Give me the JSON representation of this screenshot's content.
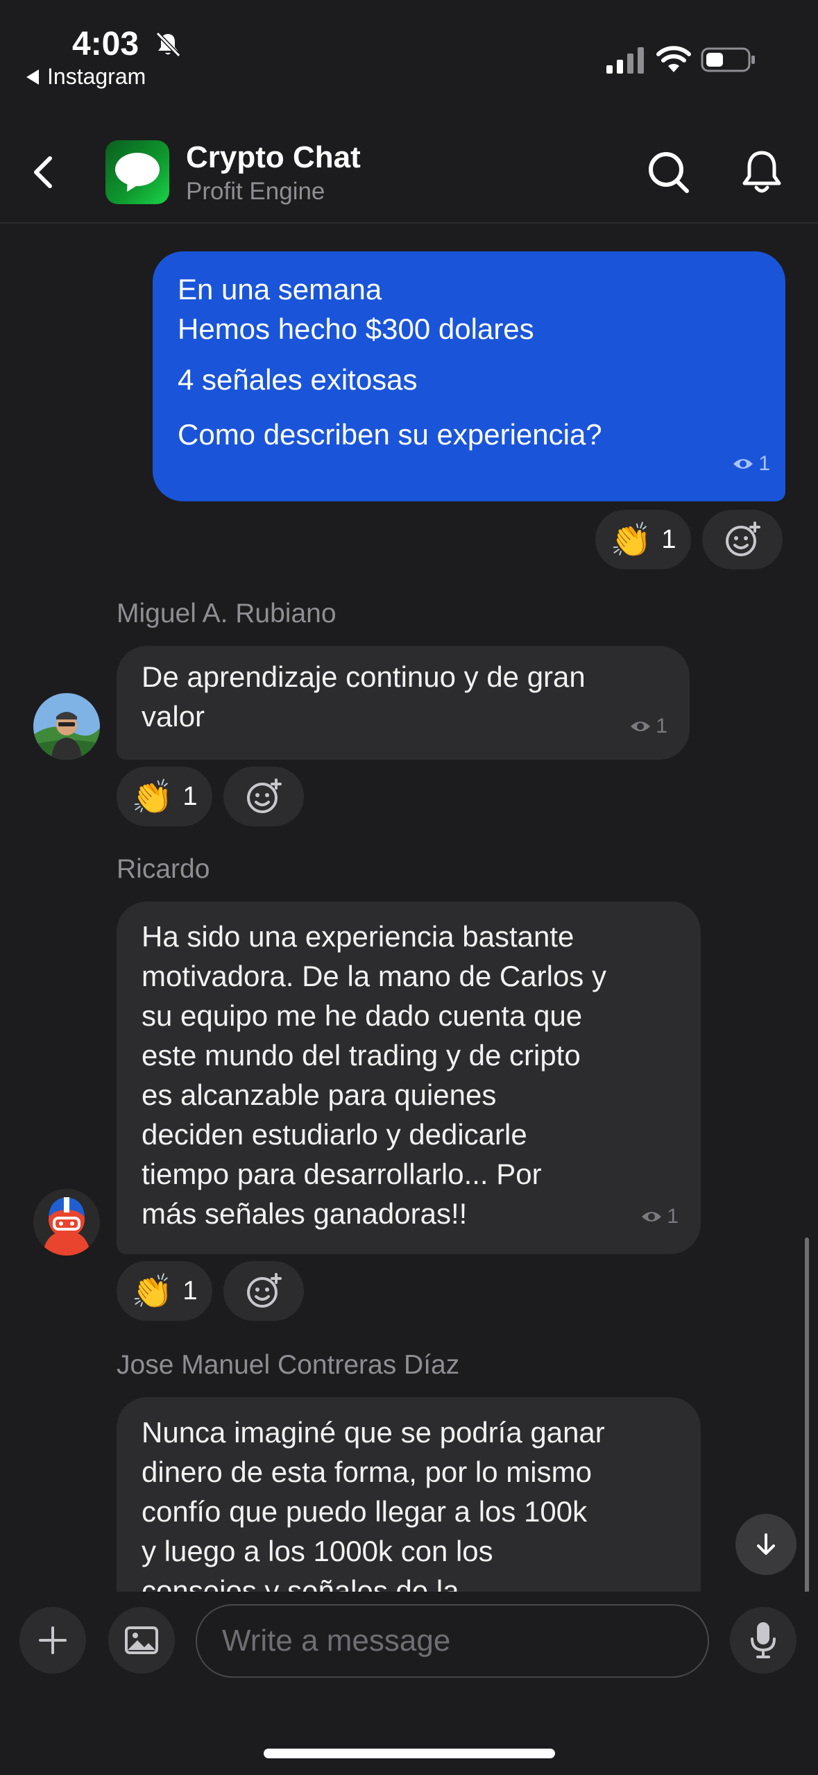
{
  "status_bar": {
    "time": "4:03",
    "back_app": "Instagram",
    "icons": [
      "bell-off-icon",
      "cellular-signal-icon",
      "wifi-icon",
      "battery-icon"
    ]
  },
  "header": {
    "title": "Crypto Chat",
    "subtitle": "Profit Engine",
    "icons": [
      "back-icon",
      "chat-logo",
      "search-icon",
      "bell-icon"
    ]
  },
  "messages": [
    {
      "direction": "out",
      "lines": [
        "En una semana",
        "Hemos hecho $300 dolares",
        "",
        "4 señales exitosas",
        "",
        "Como describen su experiencia?"
      ],
      "views": "1",
      "reaction": {
        "emoji": "👏",
        "count": "1"
      }
    },
    {
      "direction": "in",
      "sender": "Miguel A. Rubiano",
      "lines": [
        "De aprendizaje continuo y de gran",
        "valor"
      ],
      "views": "1",
      "reaction": {
        "emoji": "👏",
        "count": "1"
      }
    },
    {
      "direction": "in",
      "sender": "Ricardo",
      "lines": [
        "Ha sido una experiencia bastante",
        "motivadora. De la mano de Carlos y",
        "su equipo me he dado cuenta que",
        "este mundo del trading y de cripto",
        "es alcanzable para quienes",
        "deciden estudiarlo y dedicarle",
        "tiempo para desarrollarlo... Por",
        "más señales ganadoras!!"
      ],
      "views": "1",
      "reaction": {
        "emoji": "👏",
        "count": "1"
      }
    },
    {
      "direction": "in",
      "sender": "Jose Manuel Contreras Díaz",
      "lines": [
        "Nunca imaginé que se podría ganar",
        "dinero de esta forma, por lo mismo",
        "confío que puedo llegar a los 100k",
        "y luego a los 1000k con los",
        "consejos y señales de la"
      ]
    }
  ],
  "composer": {
    "placeholder": "Write a message",
    "icons": [
      "plus-icon",
      "image-icon",
      "microphone-icon",
      "arrow-down-icon"
    ]
  },
  "colors": {
    "background": "#1c1c1e",
    "outgoing_bubble": "#1a55d9",
    "incoming_bubble": "#2c2c2e",
    "secondary_text": "#8e8e93"
  }
}
